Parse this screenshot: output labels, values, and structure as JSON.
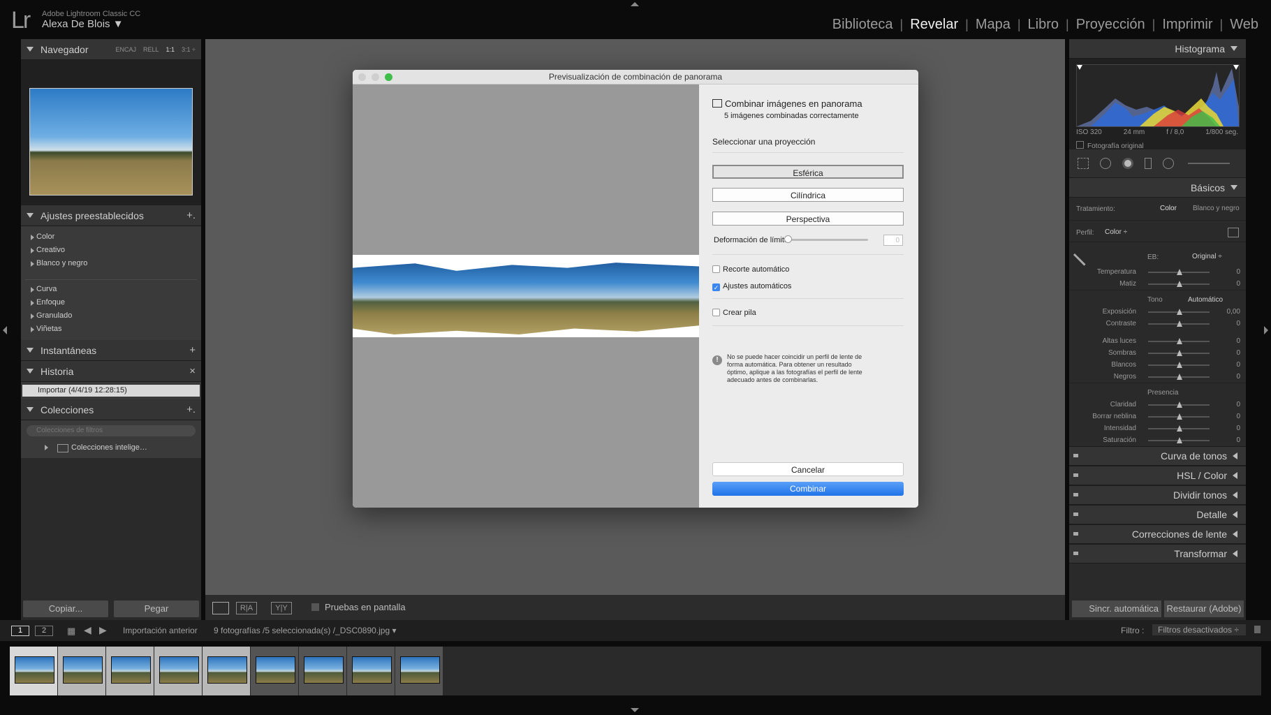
{
  "app": {
    "logo": "Lr",
    "name": "Adobe Lightroom Classic CC",
    "user": "Alexa De Blois ▼"
  },
  "modules": [
    {
      "label": "Biblioteca",
      "active": false
    },
    {
      "label": "Revelar",
      "active": true
    },
    {
      "label": "Mapa",
      "active": false
    },
    {
      "label": "Libro",
      "active": false
    },
    {
      "label": "Proyección",
      "active": false
    },
    {
      "label": "Imprimir",
      "active": false
    },
    {
      "label": "Web",
      "active": false
    }
  ],
  "left": {
    "navigator": {
      "title": "Navegador",
      "opts": [
        "ENCAJ",
        "RELL",
        "1:1",
        "3:1 ÷"
      ],
      "active_opt": "1:1"
    },
    "presets": {
      "title": "Ajustes preestablecidos",
      "add": "+.",
      "group1": [
        "Color",
        "Creativo",
        "Blanco y negro"
      ],
      "group2": [
        "Curva",
        "Enfoque",
        "Granulado",
        "Viñetas"
      ]
    },
    "snapshots": {
      "title": "Instantáneas",
      "add": "+"
    },
    "history": {
      "title": "Historia",
      "close": "×",
      "items": [
        "Importar (4/4/19 12:28:15)"
      ]
    },
    "collections": {
      "title": "Colecciones",
      "add": "+.",
      "filter_placeholder": "Colecciones de filtros",
      "items": [
        "Colecciones intelige…"
      ]
    },
    "copy_label": "Copiar...",
    "paste_label": "Pegar"
  },
  "toolbar": {
    "compare_label": "R|A",
    "survey_label": "Y|Y",
    "proof_label": "Pruebas en pantalla"
  },
  "dialog": {
    "title": "Previsualización de combinación de panorama",
    "heading": "Combinar imágenes en panorama",
    "status": "5 imágenes combinadas correctamente",
    "projection_label": "Seleccionar una proyección",
    "projections": [
      {
        "label": "Esférica",
        "selected": true
      },
      {
        "label": "Cilíndrica",
        "selected": false
      },
      {
        "label": "Perspectiva",
        "selected": false
      }
    ],
    "boundary_label": "Deformación de límite:",
    "boundary_value": "0",
    "auto_crop": {
      "label": "Recorte automático",
      "checked": false
    },
    "auto_settings": {
      "label": "Ajustes automáticos",
      "checked": true
    },
    "create_stack": {
      "label": "Crear pila",
      "checked": false
    },
    "warning": "No se puede hacer coincidir un perfil de lente de forma automática. Para obtener un resultado óptimo, aplique a las fotografías el perfil de lente adecuado antes de combinarlas.",
    "cancel_label": "Cancelar",
    "merge_label": "Combinar"
  },
  "right": {
    "histogram": {
      "title": "Histograma",
      "iso": "ISO 320",
      "focal": "24 mm",
      "aperture": "f / 8,0",
      "shutter": "1/800 seg.",
      "original": "Fotografía original"
    },
    "basic": {
      "title": "Básicos",
      "treatment_label": "Tratamiento:",
      "treatment_color": "Color",
      "treatment_bw": "Blanco y negro",
      "profile_label": "Perfil:",
      "profile_value": "Color ÷",
      "wb_label": "EB:",
      "wb_value": "Original ÷",
      "tone_label": "Tono",
      "tone_auto": "Automático",
      "presence_label": "Presencia",
      "wb_sliders": [
        {
          "label": "Temperatura",
          "value": "0"
        },
        {
          "label": "Matiz",
          "value": "0"
        }
      ],
      "tone_sliders1": [
        {
          "label": "Exposición",
          "value": "0,00"
        },
        {
          "label": "Contraste",
          "value": "0"
        }
      ],
      "tone_sliders2": [
        {
          "label": "Altas luces",
          "value": "0"
        },
        {
          "label": "Sombras",
          "value": "0"
        },
        {
          "label": "Blancos",
          "value": "0"
        },
        {
          "label": "Negros",
          "value": "0"
        }
      ],
      "presence_sliders": [
        {
          "label": "Claridad",
          "value": "0"
        },
        {
          "label": "Borrar neblina",
          "value": "0"
        },
        {
          "label": "Intensidad",
          "value": "0"
        },
        {
          "label": "Saturación",
          "value": "0"
        }
      ]
    },
    "collapsed": [
      "Curva de tonos",
      "HSL / Color",
      "Dividir tonos",
      "Detalle",
      "Correcciones de lente",
      "Transformar"
    ],
    "sync_label": "Sincr. automática",
    "reset_label": "Restaurar (Adobe)"
  },
  "filmbar": {
    "page1": "1",
    "page2": "2",
    "source": "Importación anterior",
    "info": "9 fotografías /5 seleccionada(s) /_DSC0890.jpg ▾",
    "filter_label": "Filtro :",
    "filter_value": "Filtros desactivados ÷"
  },
  "filmstrip": {
    "count": 9,
    "selected": [
      0,
      1,
      2,
      3,
      4
    ],
    "active": 0
  }
}
